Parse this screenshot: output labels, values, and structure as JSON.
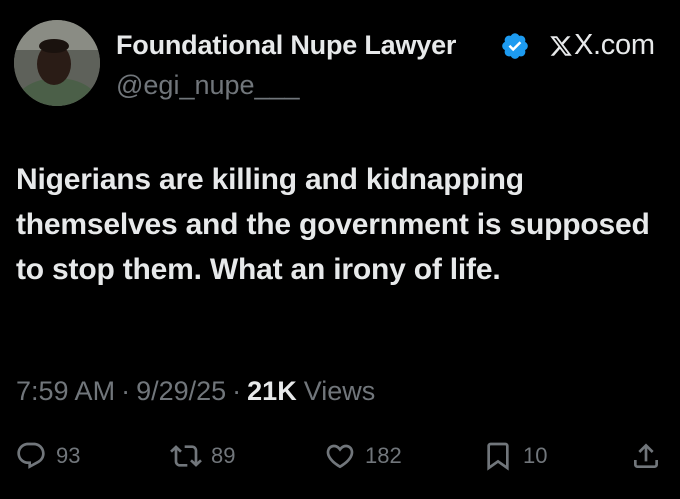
{
  "author": {
    "display_name": "Foundational Nupe Lawyer",
    "handle": "@egi_nupe___",
    "verified": true,
    "verified_color": "#1d9bf0"
  },
  "source": {
    "label": "X.com"
  },
  "tweet": {
    "text": "Nigerians are killing and kidnapping themselves and the government is supposed to stop them. What an irony of life."
  },
  "meta": {
    "time": "7:59 AM",
    "separator": "·",
    "date": "9/29/25",
    "views_count": "21K",
    "views_label": "Views"
  },
  "actions": {
    "replies": "93",
    "reposts": "89",
    "likes": "182",
    "bookmarks": "10"
  },
  "colors": {
    "background": "#000000",
    "primary_text": "#e7e9ea",
    "secondary_text": "#71767b"
  }
}
